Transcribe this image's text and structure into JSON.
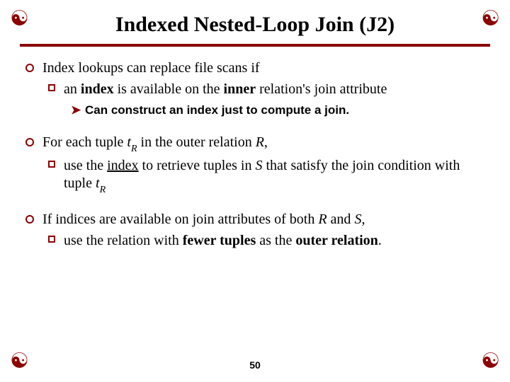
{
  "corner_symbol": "☯",
  "title": "Indexed Nested-Loop Join (J2)",
  "page_number": "50",
  "bullets": [
    {
      "text": "Index lookups can replace file scans if",
      "sub": [
        {
          "pre": "an ",
          "bold1": "index",
          "mid": " is available on the ",
          "bold2": "inner",
          "post": " relation's join attribute"
        }
      ],
      "note": "Can construct an index just to compute a join."
    },
    {
      "pre": "For each tuple ",
      "var1": "t",
      "subvar1": "R",
      "mid1": " in the outer relation ",
      "var2": "R",
      "post1": ",",
      "sub": [
        {
          "pre": "use the ",
          "u1": "index",
          "mid": " to retrieve tuples in ",
          "var": "S",
          "mid2": " that satisfy the join condition with tuple ",
          "var2": "t",
          "subvar2": "R"
        }
      ]
    },
    {
      "pre": "If indices are available on join attributes of both ",
      "var1": "R",
      "mid": " and ",
      "var2": "S",
      "post": ",",
      "sub": [
        {
          "pre": "use the relation with ",
          "b1": "fewer tuples",
          "mid": " as the ",
          "b2": "outer relation",
          "post": "."
        }
      ]
    }
  ]
}
